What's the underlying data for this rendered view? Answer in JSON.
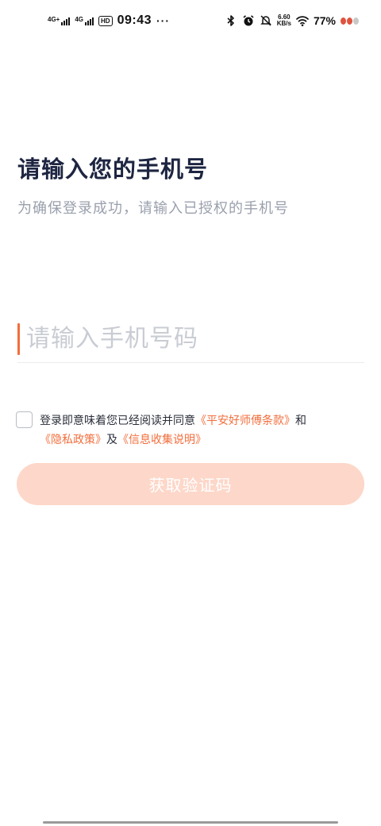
{
  "status_bar": {
    "net1": "4G+",
    "net2": "4G",
    "hd": "HD",
    "time": "09:43",
    "more": "···",
    "speed_value": "6.60",
    "speed_unit": "KB/s",
    "battery": "77%",
    "icons": [
      "bluetooth-icon",
      "alarm-icon",
      "mute-icon",
      "wifi-icon"
    ]
  },
  "header": {
    "title": "请输入您的手机号",
    "subtitle": "为确保登录成功，请输入已授权的手机号"
  },
  "form": {
    "phone_placeholder": "请输入手机号码",
    "phone_value": "",
    "agreement": {
      "checked": false,
      "prefix": "登录即意味着您已经阅读并同意",
      "link1": "《平安好师傅条款》",
      "and": "和",
      "link2": "《隐私政策》",
      "and2": "及",
      "link3": "《信息收集说明》"
    },
    "submit_label": "获取验证码"
  },
  "colors": {
    "accent": "#f26e3c",
    "title": "#1d2541",
    "subtitle": "#9aa0ad",
    "button_disabled": "#fdd7c9"
  }
}
